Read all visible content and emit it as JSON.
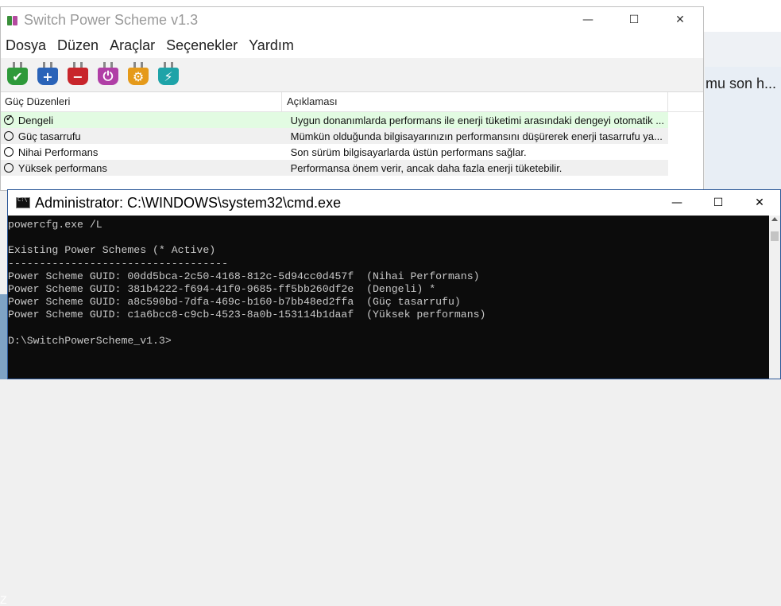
{
  "background": {
    "partial_text": "mu son h..."
  },
  "sps_window": {
    "title": "Switch Power Scheme v1.3",
    "controls": {
      "minimize": "—",
      "maximize": "☐",
      "close": "✕"
    },
    "menu": [
      "Dosya",
      "Düzen",
      "Araçlar",
      "Seçenekler",
      "Yardım"
    ],
    "toolbar": [
      {
        "name": "activate",
        "color": "#2e9a3a",
        "glyph": "✔"
      },
      {
        "name": "add",
        "color": "#2a63b8",
        "glyph": "+"
      },
      {
        "name": "remove",
        "color": "#c8252b",
        "glyph": "−"
      },
      {
        "name": "plug",
        "color": "#b03fa6",
        "glyph": "⏻"
      },
      {
        "name": "settings",
        "color": "#e59a1a",
        "glyph": "⚙"
      },
      {
        "name": "power",
        "color": "#1ea3a8",
        "glyph": "⚡"
      }
    ],
    "columns": [
      "Güç Düzenleri",
      "Açıklaması"
    ],
    "rows": [
      {
        "name": "Dengeli",
        "desc": "Uygun donanımlarda performans ile enerji tüketimi arasındaki dengeyi otomatik ...",
        "active": true
      },
      {
        "name": "Güç tasarrufu",
        "desc": "Mümkün olduğunda bilgisayarınızın performansını düşürerek enerji tasarrufu ya...",
        "active": false
      },
      {
        "name": "Nihai Performans",
        "desc": "Son sürüm bilgisayarlarda üstün performans sağlar.",
        "active": false
      },
      {
        "name": "Yüksek performans",
        "desc": "Performansa önem verir, ancak daha fazla enerji tüketebilir.",
        "active": false
      }
    ]
  },
  "cmd_window": {
    "title": "Administrator: C:\\WINDOWS\\system32\\cmd.exe",
    "controls": {
      "minimize": "—",
      "maximize": "☐",
      "close": "✕"
    },
    "lines": [
      "powercfg.exe /L",
      "",
      "Existing Power Schemes (* Active)",
      "-----------------------------------",
      "Power Scheme GUID: 00dd5bca-2c50-4168-812c-5d94cc0d457f  (Nihai Performans)",
      "Power Scheme GUID: 381b4222-f694-41f0-9685-ff5bb260df2e  (Dengeli) *",
      "Power Scheme GUID: a8c590bd-7dfa-469c-b160-b7bb48ed2ffa  (Güç tasarrufu)",
      "Power Scheme GUID: c1a6bcc8-c9cb-4523-8a0b-153114b1daaf  (Yüksek performans)",
      "",
      "D:\\SwitchPowerScheme_v1.3>"
    ]
  }
}
